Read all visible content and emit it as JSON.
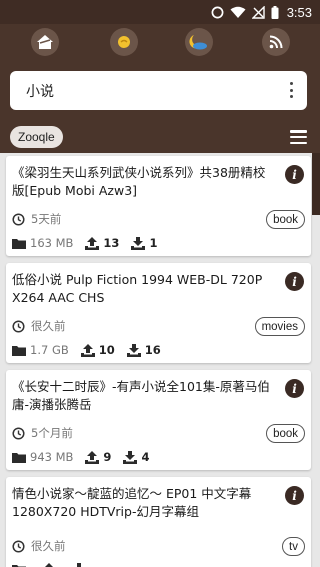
{
  "status_bar": {
    "time": "3:53"
  },
  "toolbar": {
    "icons": [
      "home-icon",
      "sun-icon",
      "night-icon",
      "rss-icon"
    ]
  },
  "search": {
    "query": "小说"
  },
  "engine": {
    "label": "Zooqle"
  },
  "results": [
    {
      "title": "《梁羽生天山系列武侠小说系列》共38册精校版[Epub Mobi Azw3]",
      "time": "5天前",
      "category": "book",
      "size": "163 MB",
      "seeders": "13",
      "leechers": "1"
    },
    {
      "title": "低俗小说 Pulp Fiction 1994 WEB-DL 720P X264 AAC CHS",
      "time": "很久前",
      "category": "movies",
      "size": "1.7 GB",
      "seeders": "10",
      "leechers": "16"
    },
    {
      "title": "《长安十二时辰》-有声小说全101集-原著马伯庸-演播张腾岳",
      "time": "5个月前",
      "category": "book",
      "size": "943 MB",
      "seeders": "9",
      "leechers": "4"
    },
    {
      "title": "情色小说家〜靛蓝的追忆〜 EP01 中文字幕 1280X720 HDTVrip-幻月字幕组",
      "time": "很久前",
      "category": "tv",
      "size": "",
      "seeders": "",
      "leechers": ""
    }
  ],
  "colors": {
    "header_bg": "#4a352b",
    "status_bg": "#3f2c24",
    "list_bg": "#e7e7e7",
    "accent": "#3a2a24"
  }
}
